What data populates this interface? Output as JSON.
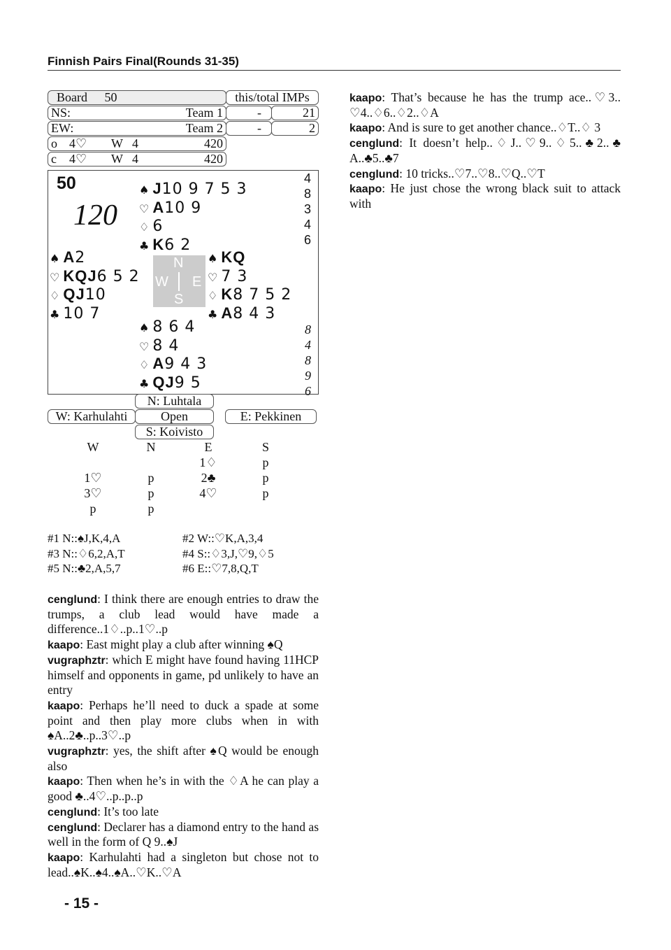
{
  "header": {
    "title": "Finnish Pairs Final(Rounds 31-35)"
  },
  "board": {
    "label": "Board",
    "number": "50",
    "imps_header": "this/total IMPs",
    "ns": {
      "label": "NS:",
      "team": "Team 1",
      "this": "-",
      "total": "21"
    },
    "ew": {
      "label": "EW:",
      "team": "Team 2",
      "this": "-",
      "total": "2"
    },
    "open": {
      "room": "o",
      "contract": "4♡",
      "declarer": "W",
      "tricks": "4",
      "score": "420"
    },
    "closed": {
      "room": "c",
      "contract": "4♡",
      "declarer": "W",
      "tricks": "4",
      "score": "420"
    }
  },
  "deal": {
    "board_no": "50",
    "par": "120",
    "north": {
      "spades": {
        "hon": "J",
        "rest": "10 9 7 5 3"
      },
      "hearts": {
        "hon": "A",
        "rest": "10 9"
      },
      "diamonds": {
        "hon": "",
        "rest": "6"
      },
      "clubs": {
        "hon": "K",
        "rest": "6 2"
      }
    },
    "west": {
      "spades": {
        "hon": "A",
        "rest": "2"
      },
      "hearts": {
        "hon": "KQJ",
        "rest": "6 5 2"
      },
      "diamonds": {
        "hon": "QJ",
        "rest": "10"
      },
      "clubs": {
        "hon": "",
        "rest": "10 7"
      }
    },
    "east": {
      "spades": {
        "hon": "KQ",
        "rest": ""
      },
      "hearts": {
        "hon": "",
        "rest": "7 3"
      },
      "diamonds": {
        "hon": "K",
        "rest": "8 7 5 2"
      },
      "clubs": {
        "hon": "A",
        "rest": "8 4 3"
      }
    },
    "south": {
      "spades": {
        "hon": "",
        "rest": "8 6 4"
      },
      "hearts": {
        "hon": "",
        "rest": "8 4"
      },
      "diamonds": {
        "hon": "A",
        "rest": "9 4 3"
      },
      "clubs": {
        "hon": "QJ",
        "rest": "9 5"
      }
    },
    "tricks_top": [
      "4",
      "8",
      "3",
      "4",
      "6"
    ],
    "tricks_bottom": [
      "8",
      "4",
      "8",
      "9",
      "6"
    ],
    "compass": {
      "n": "N",
      "w": "W",
      "e": "E",
      "s": "S"
    }
  },
  "players": {
    "north": "N: Luhtala",
    "west": "W: Karhulahti",
    "room": "Open",
    "east": "E: Pekkinen",
    "south": "S: Koivisto"
  },
  "auction": {
    "headers": [
      "W",
      "N",
      "E",
      "S"
    ],
    "rows": [
      [
        "",
        "",
        "1♢",
        "p"
      ],
      [
        "1♡",
        "p",
        "2♣",
        "p"
      ],
      [
        "3♡",
        "p",
        "4♡",
        "p"
      ],
      [
        "p",
        "p",
        "",
        ""
      ]
    ]
  },
  "tricks": [
    "#1 N::♠J,K,4,A",
    "#2 W::♡K,A,3,4",
    "#3 N::♢6,2,A,T",
    "#4 S::♢3,J,♡9,♢5",
    "#5 N::♣2,A,5,7",
    "#6 E::♡7,8,Q,T"
  ],
  "comments_left": [
    {
      "speaker": "cenglund",
      "text": ": I think there are enough entries to draw the trumps, a club lead would have made a difference..1♢..p..1♡..p"
    },
    {
      "speaker": "kaapo",
      "text": ": East might play a club after winning ♠Q"
    },
    {
      "speaker": "vugraphztr",
      "text": ": which E might have found having 11HCP himself and opponents in game, pd unlikely to have an entry"
    },
    {
      "speaker": "kaapo",
      "text": ": Perhaps he’ll need to duck a spade at some point and then play more clubs when in with ♠A..2♣..p..3♡..p"
    },
    {
      "speaker": "vugraphztr",
      "text": ": yes, the shift after ♠Q would be enough also"
    },
    {
      "speaker": "kaapo",
      "text": ": Then when he’s in with the ♢A he can play a good ♣..4♡..p..p..p"
    },
    {
      "speaker": "cenglund",
      "text": ": It’s too late"
    },
    {
      "speaker": "cenglund",
      "text": ": Declarer has a diamond entry to the hand as well in the form of Q 9..♠J"
    },
    {
      "speaker": "kaapo",
      "text": ": Karhulahti had a singleton but chose not to lead..♠K..♠4..♠A..♡K..♡A"
    }
  ],
  "comments_right": [
    {
      "speaker": "kaapo",
      "text": ": That’s because he has the trump ace..♡3.. ♡4..♢6..♢2..♢A"
    },
    {
      "speaker": "kaapo",
      "text": ": And is sure to get another chance..♢T..♢ 3"
    },
    {
      "speaker": "cenglund",
      "text": ": It doesn’t help..♢J..♡9..♢5..♣2..♣ A..♣5..♣7"
    },
    {
      "speaker": "cenglund",
      "text": ": 10 tricks..♡7..♡8..♡Q..♡T"
    },
    {
      "speaker": "kaapo",
      "text": ": He just chose the wrong black suit to attack with"
    }
  ],
  "footer": {
    "page": "- 15 -"
  }
}
